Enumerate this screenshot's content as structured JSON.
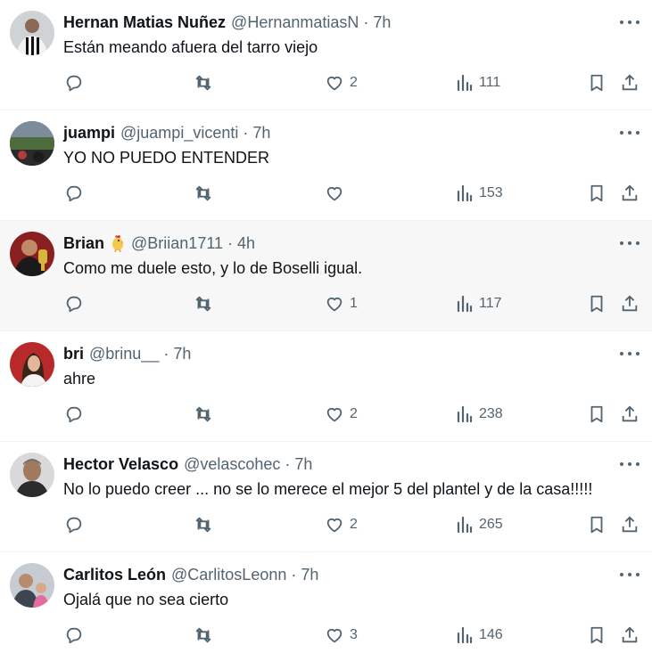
{
  "posts": [
    {
      "name": "Hernan Matias Nuñez",
      "emoji": "",
      "handle": "@HernanmatiasN",
      "time": "7h",
      "text": "Están meando afuera del tarro viejo",
      "likes": "2",
      "views": "111",
      "avatar": "player-in-striped-shirt"
    },
    {
      "name": "juampi",
      "emoji": "",
      "handle": "@juampi_vicenti",
      "time": "7h",
      "text": "YO NO PUEDO ENTENDER",
      "likes": "",
      "views": "153",
      "avatar": "stadium-crowd"
    },
    {
      "name": "Brian",
      "emoji": "rooster-emoji",
      "handle": "@Briian1711",
      "time": "4h",
      "text": "Como me duele esto, y lo de Boselli igual.",
      "likes": "1",
      "views": "117",
      "avatar": "man-with-trophy"
    },
    {
      "name": "bri",
      "emoji": "",
      "handle": "@brinu__",
      "time": "7h",
      "text": "ahre",
      "likes": "2",
      "views": "238",
      "avatar": "woman-red-background"
    },
    {
      "name": "Hector Velasco",
      "emoji": "",
      "handle": "@velascohec",
      "time": "7h",
      "text": "No lo puedo creer ... no se lo merece el mejor 5 del plantel y de la casa!!!!!",
      "likes": "2",
      "views": "265",
      "avatar": "older-man-portrait"
    },
    {
      "name": "Carlitos León",
      "emoji": "",
      "handle": "@CarlitosLeonn",
      "time": "7h",
      "text": "Ojalá que no sea cierto",
      "likes": "3",
      "views": "146",
      "avatar": "father-and-child"
    }
  ],
  "separator": "·",
  "colors": {
    "text": "#0f1419",
    "secondary": "#536471",
    "border": "#eff3f4",
    "highlight": "#f7f7f7"
  }
}
